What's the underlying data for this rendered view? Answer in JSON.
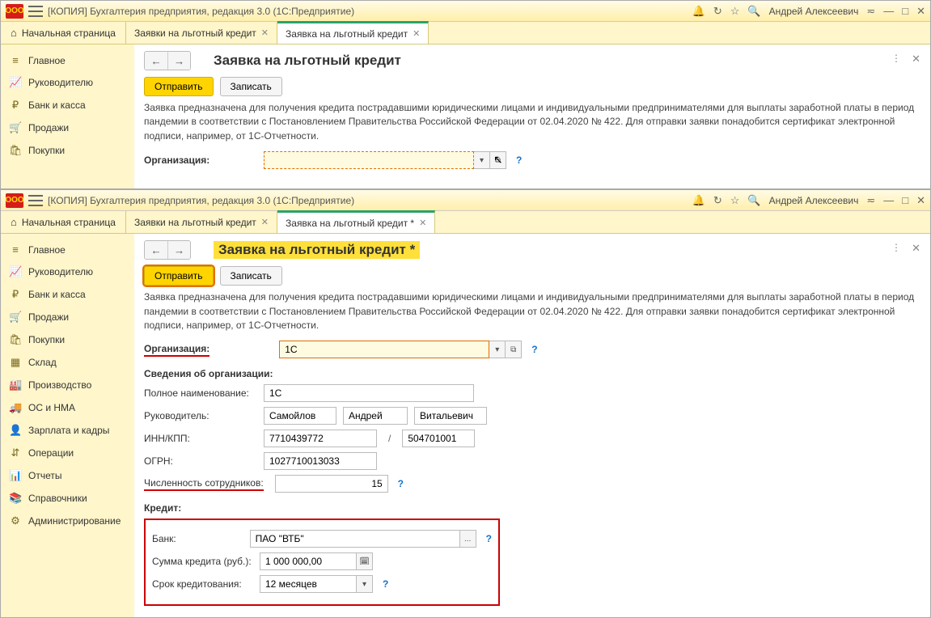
{
  "top": {
    "title": "[КОПИЯ] Бухгалтерия предприятия, редакция 3.0  (1С:Предприятие)",
    "logo_text": "OOO",
    "username": "Андрей Алексеевич",
    "tabs": {
      "home": "Начальная страница",
      "t1": "Заявки на льготный кредит",
      "t2": "Заявка на льготный кредит"
    },
    "sidebar": [
      {
        "icon": "≡",
        "label": "Главное"
      },
      {
        "icon": "📈",
        "label": "Руководителю"
      },
      {
        "icon": "₽",
        "label": "Банк и касса"
      },
      {
        "icon": "🛒",
        "label": "Продажи"
      },
      {
        "icon": "🛍",
        "label": "Покупки"
      }
    ],
    "page": {
      "title": "Заявка на льготный кредит",
      "send": "Отправить",
      "save": "Записать",
      "desc": "Заявка предназначена для получения кредита пострадавшими юридическими лицами и индивидуальными предпринимателями для выплаты заработной платы в период пандемии в соответствии с Постановлением Правительства Российской Федерации от 02.04.2020 № 422. Для отправки заявки понадобится сертификат электронной подписи, например, от 1С-Отчетности.",
      "org_label": "Организация:",
      "org_value": ""
    }
  },
  "bottom": {
    "title": "[КОПИЯ] Бухгалтерия предприятия, редакция 3.0  (1С:Предприятие)",
    "username": "Андрей Алексеевич",
    "tabs": {
      "home": "Начальная страница",
      "t1": "Заявки на льготный кредит",
      "t2": "Заявка на льготный кредит *"
    },
    "sidebar": [
      {
        "icon": "≡",
        "label": "Главное"
      },
      {
        "icon": "📈",
        "label": "Руководителю"
      },
      {
        "icon": "₽",
        "label": "Банк и касса"
      },
      {
        "icon": "🛒",
        "label": "Продажи"
      },
      {
        "icon": "🛍",
        "label": "Покупки"
      },
      {
        "icon": "▦",
        "label": "Склад"
      },
      {
        "icon": "🏭",
        "label": "Производство"
      },
      {
        "icon": "🚚",
        "label": "ОС и НМА"
      },
      {
        "icon": "👤",
        "label": "Зарплата и кадры"
      },
      {
        "icon": "⇵",
        "label": "Операции"
      },
      {
        "icon": "📊",
        "label": "Отчеты"
      },
      {
        "icon": "📚",
        "label": "Справочники"
      },
      {
        "icon": "⚙",
        "label": "Администрирование"
      }
    ],
    "page": {
      "title": "Заявка на льготный кредит *",
      "send": "Отправить",
      "save": "Записать",
      "desc": "Заявка предназначена для получения кредита пострадавшими юридическими лицами и индивидуальными предпринимателями для выплаты заработной платы в период пандемии в соответствии с Постановлением Правительства Российской Федерации от 02.04.2020 № 422. Для отправки заявки понадобится сертификат электронной подписи, например, от 1С-Отчетности.",
      "org_label": "Организация:",
      "org_value": "1С",
      "section_org": "Сведения об организации:",
      "full_name_label": "Полное наименование:",
      "full_name_value": "1С",
      "head_label": "Руководитель:",
      "head_last": "Самойлов",
      "head_first": "Андрей",
      "head_mid": "Витальевич",
      "inn_label": "ИНН/КПП:",
      "inn_value": "7710439772",
      "kpp_value": "504701001",
      "ogrn_label": "ОГРН:",
      "ogrn_value": "1027710013033",
      "staff_label": "Численность сотрудников:",
      "staff_value": "15",
      "section_credit": "Кредит:",
      "bank_label": "Банк:",
      "bank_value": "ПАО \"ВТБ\"",
      "amount_label": "Сумма кредита (руб.):",
      "amount_value": "1 000 000,00",
      "term_label": "Срок кредитования:",
      "term_value": "12 месяцев"
    }
  },
  "glyph": {
    "bell": "🔔",
    "clock": "↻",
    "star": "☆",
    "search": "🔍",
    "menu2": "≂",
    "min": "—",
    "max": "□",
    "close": "✕",
    "back": "←",
    "fwd": "→",
    "kebab": "⋮",
    "dd": "▾",
    "open": "⧉",
    "help": "?",
    "dots": "...",
    "calc": "🗓",
    "slash": "/"
  }
}
